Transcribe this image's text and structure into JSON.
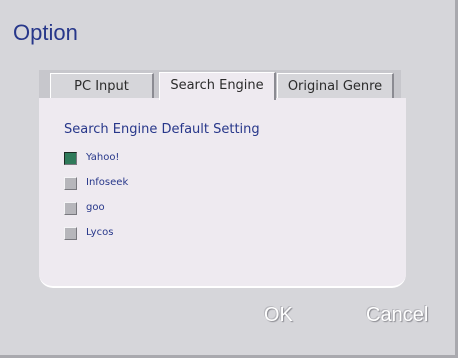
{
  "window": {
    "title": "Option"
  },
  "tabs": [
    {
      "label": "PC Input",
      "active": false
    },
    {
      "label": "Search Engine",
      "active": true
    },
    {
      "label": "Original Genre",
      "active": false
    }
  ],
  "panel": {
    "section_title": "Search Engine Default Setting",
    "options": [
      {
        "label": "Yahoo!",
        "checked": true
      },
      {
        "label": "Infoseek",
        "checked": false
      },
      {
        "label": "goo",
        "checked": false
      },
      {
        "label": "Lycos",
        "checked": false
      }
    ]
  },
  "buttons": {
    "ok_label": "OK",
    "cancel_label": "Cancel"
  },
  "colors": {
    "accent_text": "#27378a",
    "checked_fill": "#2f7a5a",
    "dialog_bg": "#d6d6da",
    "panel_bg": "#eeeaf0"
  }
}
